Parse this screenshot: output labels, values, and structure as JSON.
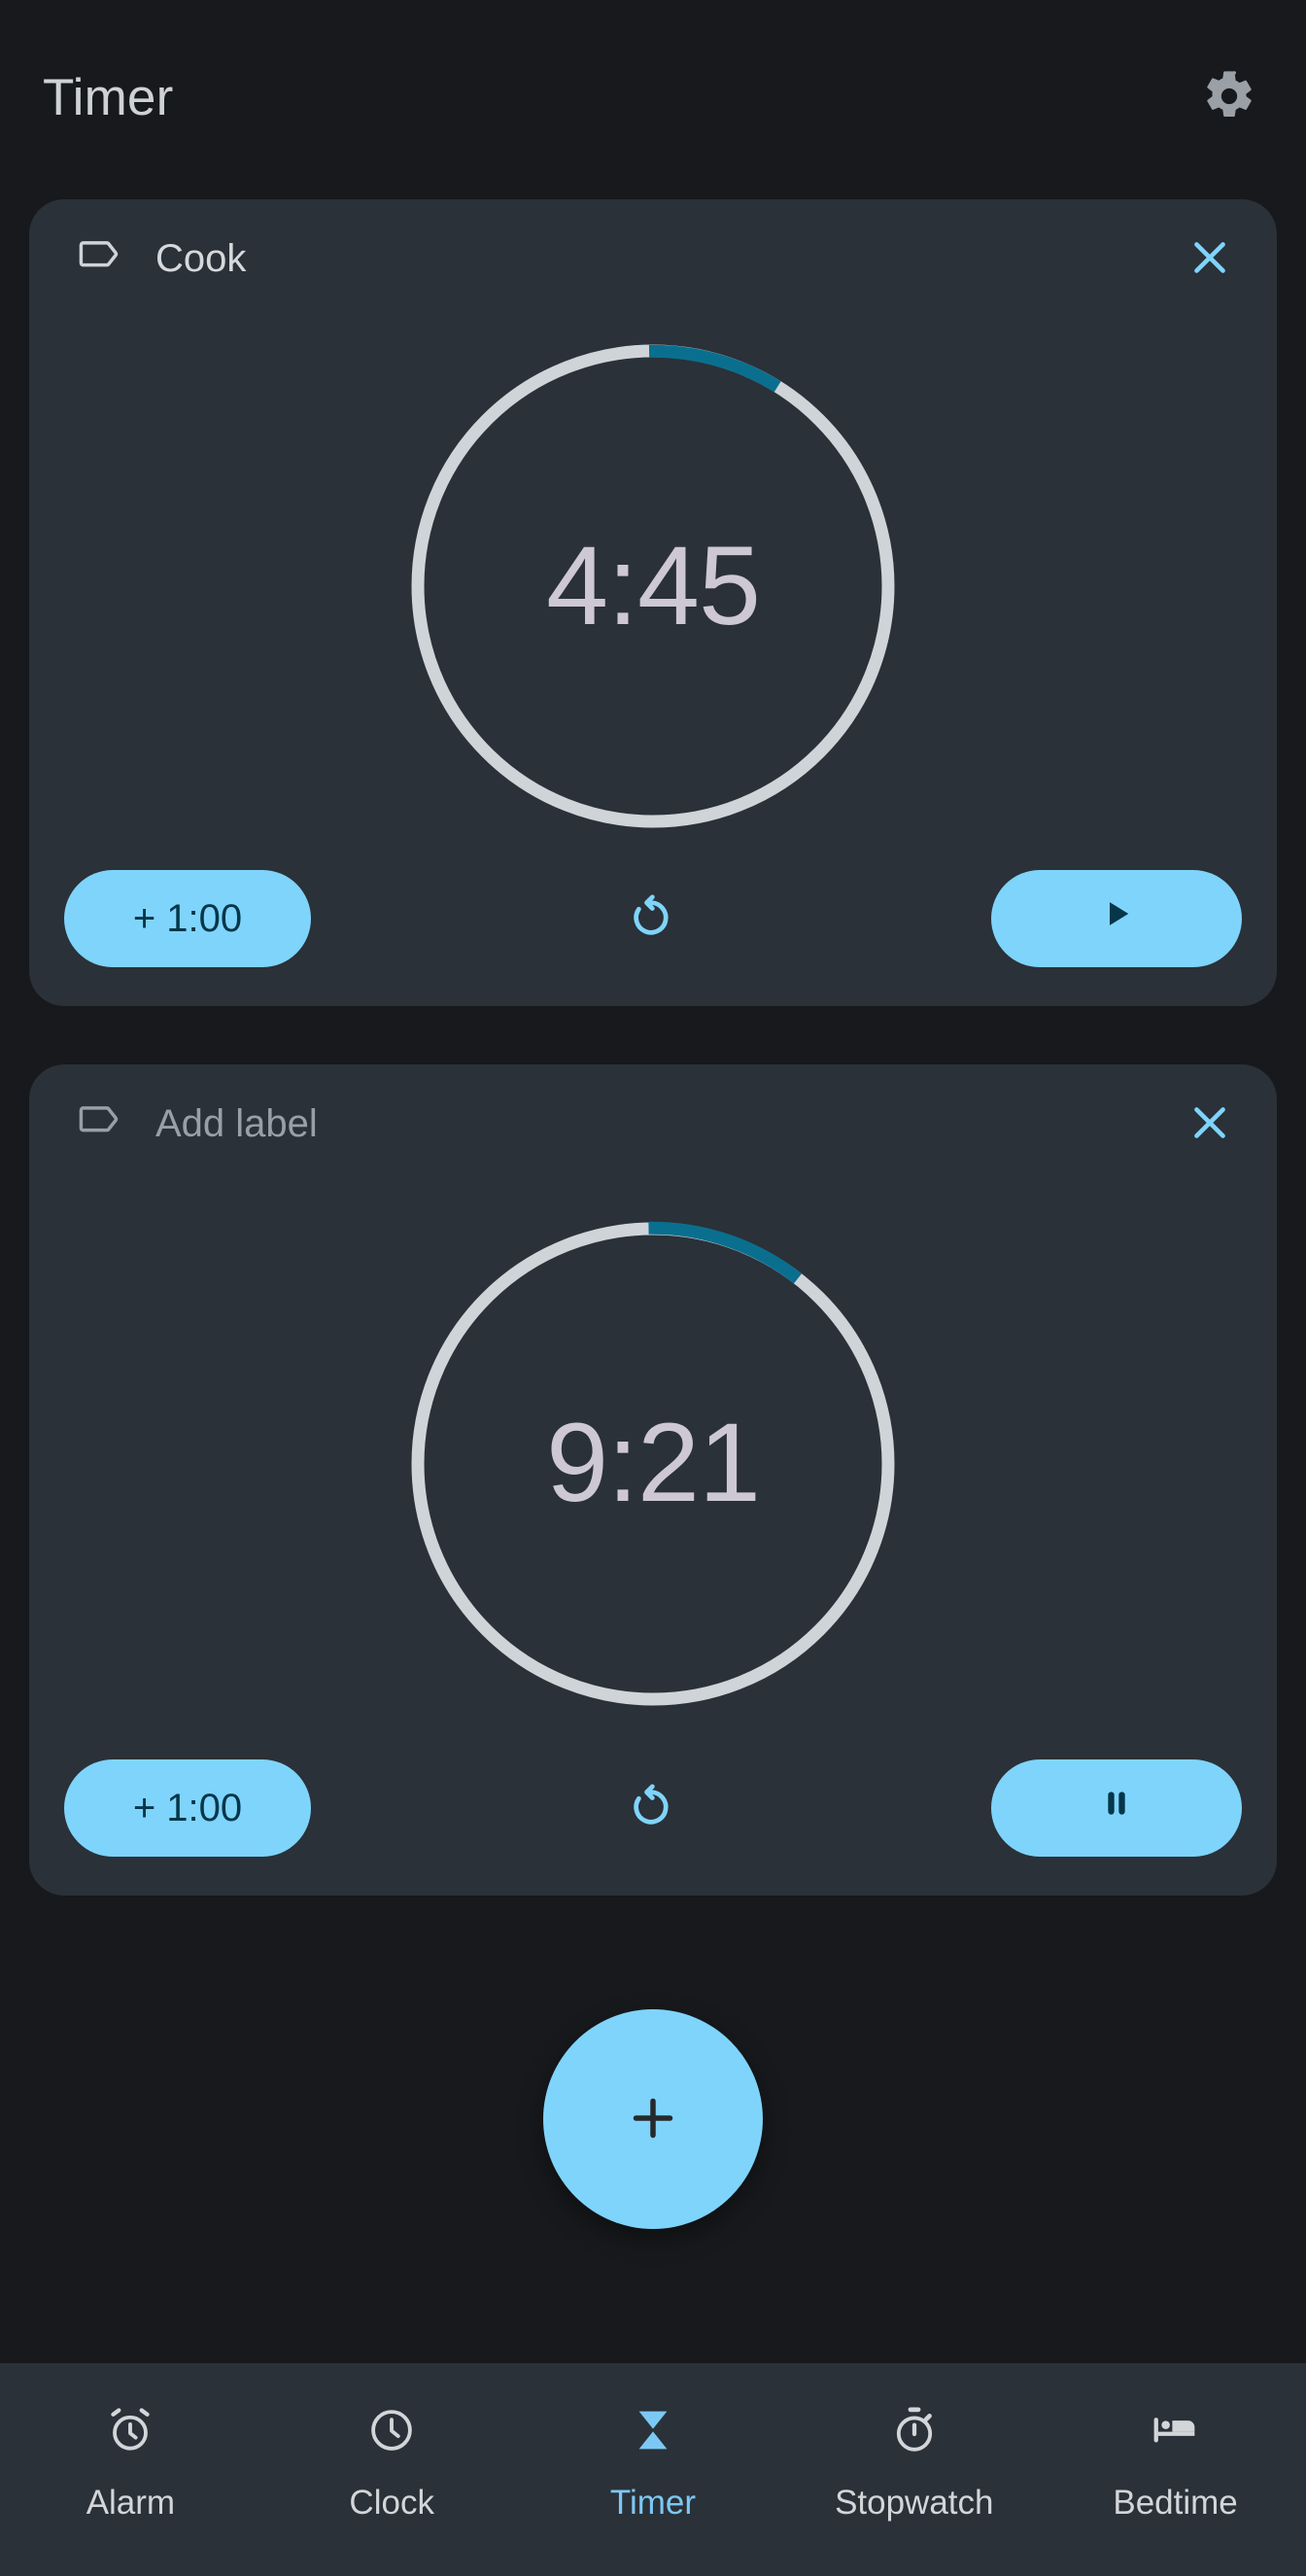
{
  "colors": {
    "page_bg": "#17191c",
    "card_bg": "#2a3138",
    "accent_blue": "#7fd4fb",
    "accent_blue_text": "#7cc8f5",
    "arc_progress": "#0a6f8f",
    "arc_track": "#cfd4d8",
    "time_text": "#cdc8d4",
    "icon_gray": "#9aa0a6",
    "on_accent": "#05364a"
  },
  "header": {
    "title": "Timer",
    "settings_icon": "gear-icon"
  },
  "timers": [
    {
      "label": "Cook",
      "label_is_placeholder": false,
      "label_icon": "label-tag-icon",
      "close_icon": "close-icon",
      "time": "4:45",
      "progress_fraction": 0.088,
      "progress_start_fraction": 0.0,
      "add_minute_label": "+ 1:00",
      "reset_icon": "reset-icon",
      "primary_action": "play",
      "primary_icon": "play-icon",
      "state": "paused"
    },
    {
      "label": "Add label",
      "label_is_placeholder": true,
      "label_icon": "label-tag-icon",
      "close_icon": "close-icon",
      "time": "9:21",
      "progress_fraction": 0.115,
      "progress_start_fraction": 0.0,
      "add_minute_label": "+ 1:00",
      "reset_icon": "reset-icon",
      "primary_action": "pause",
      "primary_icon": "pause-icon",
      "state": "running"
    }
  ],
  "fab": {
    "icon": "plus-icon",
    "name": "add-timer"
  },
  "bottom_nav": {
    "active_index": 2,
    "items": [
      {
        "label": "Alarm",
        "icon": "alarm-clock-icon"
      },
      {
        "label": "Clock",
        "icon": "clock-icon"
      },
      {
        "label": "Timer",
        "icon": "hourglass-icon"
      },
      {
        "label": "Stopwatch",
        "icon": "stopwatch-icon"
      },
      {
        "label": "Bedtime",
        "icon": "bed-icon"
      }
    ]
  }
}
